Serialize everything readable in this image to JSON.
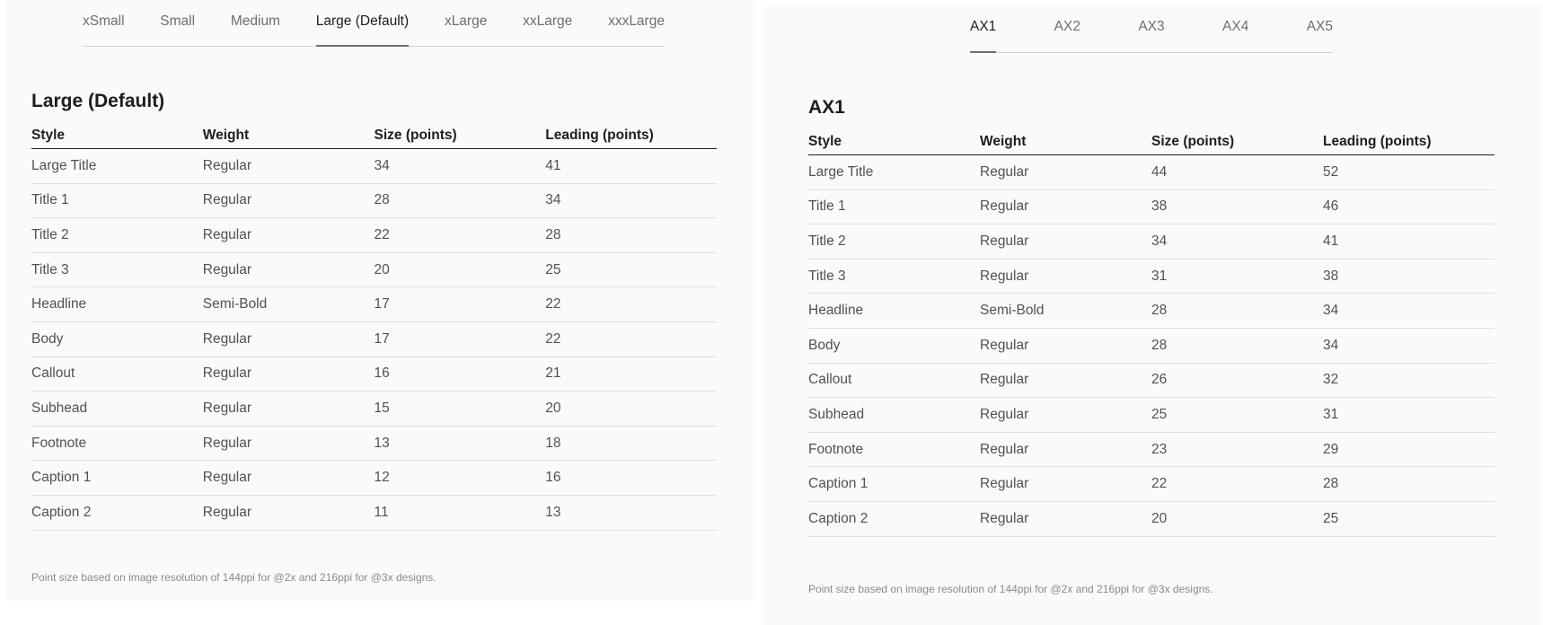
{
  "left": {
    "tabs": [
      "xSmall",
      "Small",
      "Medium",
      "Large (Default)",
      "xLarge",
      "xxLarge",
      "xxxLarge"
    ],
    "active_tab": 3,
    "heading": "Large (Default)",
    "columns": [
      "Style",
      "Weight",
      "Size (points)",
      "Leading (points)"
    ],
    "rows": [
      [
        "Large Title",
        "Regular",
        "34",
        "41"
      ],
      [
        "Title 1",
        "Regular",
        "28",
        "34"
      ],
      [
        "Title 2",
        "Regular",
        "22",
        "28"
      ],
      [
        "Title 3",
        "Regular",
        "20",
        "25"
      ],
      [
        "Headline",
        "Semi-Bold",
        "17",
        "22"
      ],
      [
        "Body",
        "Regular",
        "17",
        "22"
      ],
      [
        "Callout",
        "Regular",
        "16",
        "21"
      ],
      [
        "Subhead",
        "Regular",
        "15",
        "20"
      ],
      [
        "Footnote",
        "Regular",
        "13",
        "18"
      ],
      [
        "Caption 1",
        "Regular",
        "12",
        "16"
      ],
      [
        "Caption 2",
        "Regular",
        "11",
        "13"
      ]
    ],
    "note": "Point size based on image resolution of 144ppi for @2x and 216ppi for @3x designs."
  },
  "right": {
    "tabs": [
      "AX1",
      "AX2",
      "AX3",
      "AX4",
      "AX5"
    ],
    "active_tab": 0,
    "heading": "AX1",
    "columns": [
      "Style",
      "Weight",
      "Size (points)",
      "Leading (points)"
    ],
    "rows": [
      [
        "Large Title",
        "Regular",
        "44",
        "52"
      ],
      [
        "Title 1",
        "Regular",
        "38",
        "46"
      ],
      [
        "Title 2",
        "Regular",
        "34",
        "41"
      ],
      [
        "Title 3",
        "Regular",
        "31",
        "38"
      ],
      [
        "Headline",
        "Semi-Bold",
        "28",
        "34"
      ],
      [
        "Body",
        "Regular",
        "28",
        "34"
      ],
      [
        "Callout",
        "Regular",
        "26",
        "32"
      ],
      [
        "Subhead",
        "Regular",
        "25",
        "31"
      ],
      [
        "Footnote",
        "Regular",
        "23",
        "29"
      ],
      [
        "Caption 1",
        "Regular",
        "22",
        "28"
      ],
      [
        "Caption 2",
        "Regular",
        "20",
        "25"
      ]
    ],
    "note": "Point size based on image resolution of 144ppi for @2x and 216ppi for @3x designs."
  }
}
